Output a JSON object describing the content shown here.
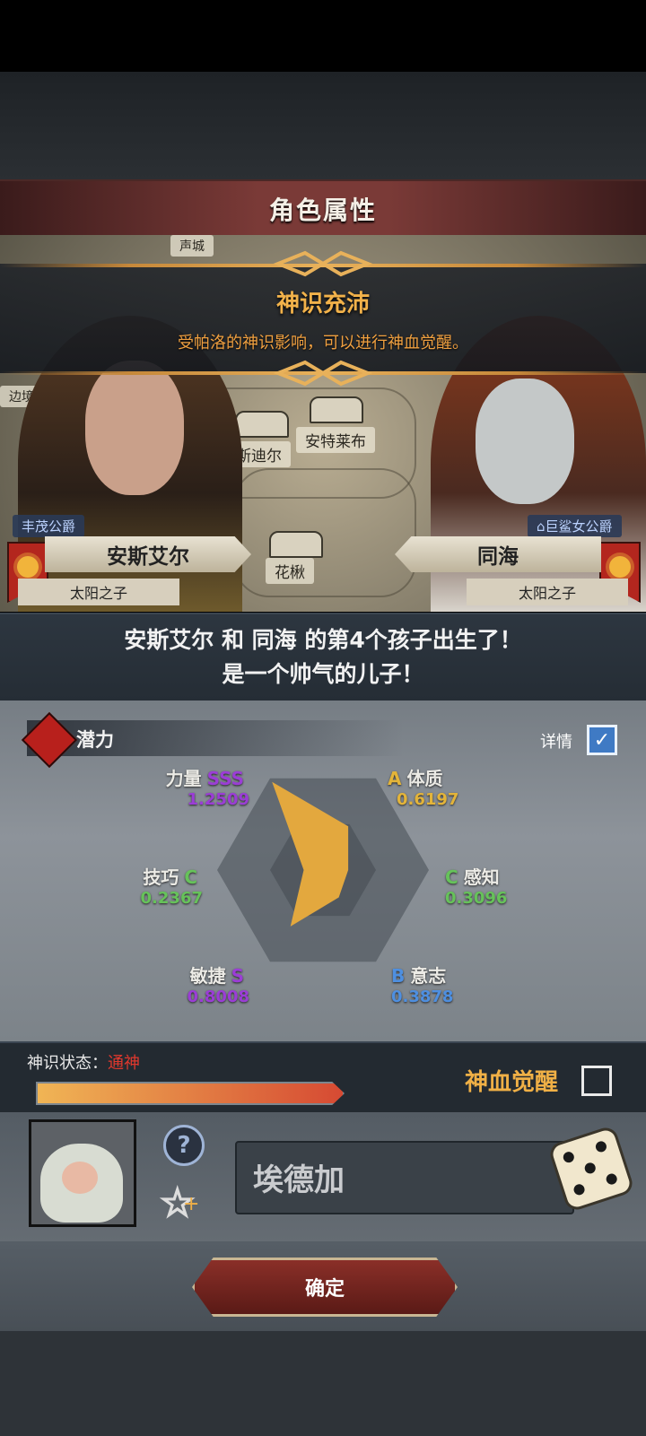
{
  "header": {
    "title": "角色属性"
  },
  "banner": {
    "title": "神识充沛",
    "subtitle": "受帕洛的神识影响，可以进行神血觉醒。"
  },
  "map": {
    "labels": [
      "莫斯迪尔",
      "安特莱布",
      "花楸",
      "声城",
      "边境"
    ]
  },
  "parents": {
    "left": {
      "rank": "丰茂公爵",
      "name": "安斯艾尔",
      "title": "太阳之子"
    },
    "right": {
      "rank": "巨鲨女公爵",
      "name": "同海",
      "title": "太阳之子"
    }
  },
  "announcement": {
    "line1": "安斯艾尔 和 同海 的第4个孩子出生了！",
    "line2": "是一个帅气的儿子！"
  },
  "potential": {
    "label": "潜力",
    "detail_label": "详情",
    "detail_checked": true,
    "stats": [
      {
        "name": "力量",
        "grade": "SSS",
        "value": "1.2509",
        "color": "#9b3dd6"
      },
      {
        "name": "体质",
        "grade": "A",
        "value": "0.6197",
        "color": "#e3b43a"
      },
      {
        "name": "感知",
        "grade": "C",
        "value": "0.3096",
        "color": "#66c25a"
      },
      {
        "name": "意志",
        "grade": "B",
        "value": "0.3878",
        "color": "#4e8fe0"
      },
      {
        "name": "敏捷",
        "grade": "S",
        "value": "0.8008",
        "color": "#9b3dd6"
      },
      {
        "name": "技巧",
        "grade": "C",
        "value": "0.2367",
        "color": "#66c25a"
      }
    ],
    "radar_max": 1.3,
    "radar_color": "#e3a83e"
  },
  "status": {
    "label": "神识状态：",
    "state": "通神",
    "progress": 1.0,
    "awaken_label": "神血觉醒",
    "awaken_checked": false
  },
  "child": {
    "name": "埃德加",
    "help_icon": "question-icon",
    "favorite_icon": "star-plus-icon",
    "random_icon": "dice-icon"
  },
  "actions": {
    "confirm_label": "确定"
  }
}
